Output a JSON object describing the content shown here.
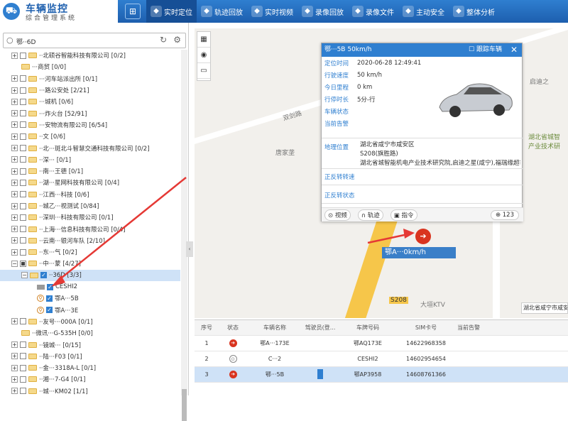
{
  "brand": {
    "title": "车辆监控",
    "subtitle": "综合管理系统"
  },
  "nav": [
    {
      "label": "实时定位",
      "icon": "location-icon",
      "active": true
    },
    {
      "label": "轨迹回放",
      "icon": "track-icon"
    },
    {
      "label": "实时视频",
      "icon": "camera-icon"
    },
    {
      "label": "录像回放",
      "icon": "video-replay-icon"
    },
    {
      "label": "录像文件",
      "icon": "film-icon"
    },
    {
      "label": "主动安全",
      "icon": "shield-icon"
    },
    {
      "label": "整体分析",
      "icon": "chart-icon"
    }
  ],
  "search": {
    "value": "鄂··6D"
  },
  "tree": [
    {
      "label": "··北硕谷智能科技有限公司 [0/2]",
      "type": "group"
    },
    {
      "label": "···商贸 [0/0]",
      "type": "folder"
    },
    {
      "label": "···河车站派出所 [0/1]",
      "type": "group"
    },
    {
      "label": "···路公安处 [2/21]",
      "type": "group"
    },
    {
      "label": "···城机 [0/6]",
      "type": "group"
    },
    {
      "label": "···炸火台 [52/91]",
      "type": "group"
    },
    {
      "label": "···安物流有限公司 [6/54]",
      "type": "group"
    },
    {
      "label": "··文 [0/6]",
      "type": "group"
    },
    {
      "label": "··北···斑北斗智慧交通科技有限公司 [0/2]",
      "type": "group"
    },
    {
      "label": "··深··· [0/1]",
      "type": "group"
    },
    {
      "label": "··南···王德 [0/1]",
      "type": "group"
    },
    {
      "label": "··湖···星网科技有限公司 [0/4]",
      "type": "group"
    },
    {
      "label": "··江西···科技 [0/6]",
      "type": "group"
    },
    {
      "label": "··城乙···视测试 [0/84]",
      "type": "group"
    },
    {
      "label": "··深圳···科技有限公司 [0/1]",
      "type": "group"
    },
    {
      "label": "··上海···信息科技有限公司 [0/4]",
      "type": "group"
    },
    {
      "label": "··云南···银河车队 [2/10]",
      "type": "group"
    },
    {
      "label": "··东···气 [0/2]",
      "type": "group"
    },
    {
      "label": "··中···蒙 [4/27]",
      "type": "open"
    },
    {
      "label": "··36D [3/3]",
      "type": "selgroup"
    },
    {
      "label": "CESHI2",
      "type": "vehicle1"
    },
    {
      "label": "鄂A···5B",
      "type": "vehicle2"
    },
    {
      "label": "鄂A···3E",
      "type": "vehicle2"
    },
    {
      "label": "··友号···000A [0/1]",
      "type": "group"
    },
    {
      "label": "··微讯···G-535H [0/0]",
      "type": "folder"
    },
    {
      "label": "··镜城··· [0/15]",
      "type": "group"
    },
    {
      "label": "··陆···F03 [0/1]",
      "type": "group"
    },
    {
      "label": "··金···3318A-L [0/1]",
      "type": "group"
    },
    {
      "label": "··湘···7-G4 [0/1]",
      "type": "group"
    },
    {
      "label": "··城···KM02 [1/1]",
      "type": "group"
    },
    {
      "label": "··城···A6BD [0/1]",
      "type": "group"
    },
    {
      "label": "··城···AZ [1/2]",
      "type": "group"
    }
  ],
  "map": {
    "labels": [
      "双剑路",
      "唐家垄",
      "启迪之",
      "湖北省城智\n产业技术研",
      "大垣KTV",
      "S208"
    ],
    "marker_label": "鄂A···0km/h",
    "note": "湖北省咸宁市咸安"
  },
  "popup": {
    "title": "鄂···5B 50km/h",
    "track_label": "跟踪车辆",
    "rows": [
      {
        "k": "定位时间",
        "v": "2020-06-28 12:49:41"
      },
      {
        "k": "行驶速度",
        "v": "50 km/h"
      },
      {
        "k": "今日里程",
        "v": "0 km"
      },
      {
        "k": "行停时长",
        "v": "5分-行"
      },
      {
        "k": "车辆状态",
        "v": ""
      },
      {
        "k": "当前告警",
        "v": ""
      }
    ],
    "address_key": "地理位置",
    "address_lines": [
      "湖北省咸宁市咸安区",
      "S208(旗胜路)",
      "湖北省城智能机电产业技术研究院,启迪之星(咸宁),福瑞缘超市"
    ],
    "forward_key": "正反转转速",
    "forward_state_key": "正反转状态",
    "buttons": [
      "视频",
      "轨迹",
      "指令"
    ],
    "count": "123"
  },
  "table": {
    "headers": [
      "序号",
      "状态",
      "车辆名称",
      "驾驶员(登...",
      "车牌号码",
      "SIM卡号",
      "当前告警"
    ],
    "rows": [
      {
        "idx": "1",
        "state": "on",
        "name": "鄂A···173E",
        "driver": "",
        "plate": "鄂AQ173E",
        "sim": "14622968358",
        "alarm": ""
      },
      {
        "idx": "2",
        "state": "off",
        "name": "C···2",
        "driver": "",
        "plate": "CESHI2",
        "sim": "14602954654",
        "alarm": ""
      },
      {
        "idx": "3",
        "state": "on",
        "name": "鄂···5B",
        "driver": "bar",
        "plate": "鄂AP3958",
        "sim": "14608761366",
        "alarm": ""
      }
    ]
  }
}
